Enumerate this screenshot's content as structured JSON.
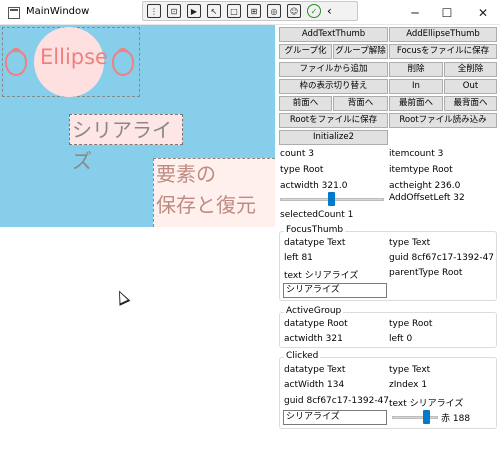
{
  "window": {
    "title": "MainWindow"
  },
  "titlebar_buttons": {
    "minimize": "─",
    "maximize": "☐",
    "close": "✕"
  },
  "debug_toolbar": {
    "check": "✓",
    "collapse": "‹"
  },
  "canvas": {
    "ellipse_text": "Ellipse",
    "serialize_text": "シリアライズ",
    "restore_line1": "要素の",
    "restore_line2": "保存と復元"
  },
  "buttons": {
    "add_text_thumb": "AddTextThumb",
    "add_ellipse_thumb": "AddEllipseThumb",
    "group": "グループ化",
    "ungroup": "グループ解除",
    "save_focus": "Focusをファイルに保存",
    "add_from_file": "ファイルから追加",
    "delete": "削除",
    "delete_all": "全削除",
    "toggle_frame": "枠の表示切り替え",
    "in": "In",
    "out": "Out",
    "forward": "前面へ",
    "backward": "背面へ",
    "front_most": "最前面へ",
    "back_most": "最背面へ",
    "save_root": "Rootをファイルに保存",
    "load_root": "Rootファイル読み込み",
    "initialize2": "Initialize2"
  },
  "root_info": {
    "count": "count 3",
    "itemcount": "itemcount 3",
    "type": "type Root",
    "itemtype": "itemtype Root",
    "actwidth": "actwidth 321.0",
    "actheight": "actheight 236.0",
    "offset_label": "AddOffsetLeft 32",
    "selected_count": "selectedCount 1"
  },
  "focus_thumb": {
    "title": "FocusThumb",
    "datatype": "datatype Text",
    "type": "type Text",
    "left": "left 81",
    "guid": "guid 8cf67c17-1392-47",
    "text": "text シリアライズ",
    "parent_type": "parentType Root",
    "input_value": "シリアライズ"
  },
  "active_group": {
    "title": "ActiveGroup",
    "datatype": "datatype Root",
    "type": "type Root",
    "actwidth": "actwidth 321",
    "left": "left 0"
  },
  "clicked": {
    "title": "Clicked",
    "datatype": "datatype Text",
    "type": "type Text",
    "actwidth": "actWidth 134",
    "zindex": "zIndex 1",
    "guid": "guid 8cf67c17-1392-47",
    "text": "text シリアライズ",
    "input_value": "シリアライズ",
    "color_label": "赤 188",
    "color_value": 188
  },
  "colors": {
    "canvas": "#87ceeb",
    "accent": "#f08080",
    "slider": "#007acc"
  }
}
